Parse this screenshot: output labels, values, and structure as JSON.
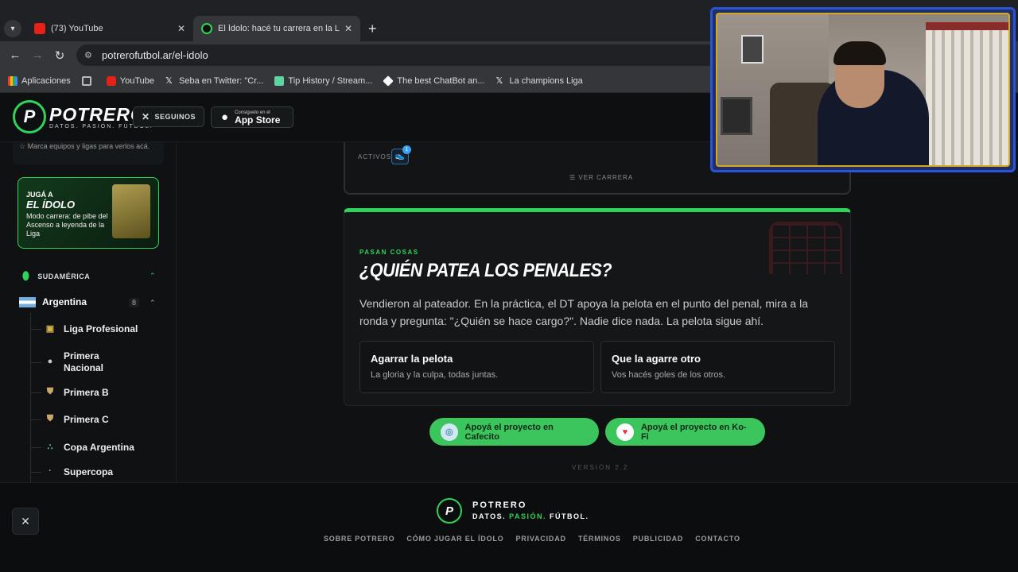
{
  "browser": {
    "tabs": [
      {
        "title": "(73) YouTube",
        "favicon": "youtube-icon"
      },
      {
        "title": "El Ídolo: hacé tu carrera en la Liga",
        "favicon": "potrero-icon"
      }
    ],
    "url": "potrerofutbol.ar/el-idolo",
    "bookmarks": [
      {
        "label": "Aplicaciones",
        "icon": "apps-grid-icon"
      },
      {
        "label": "",
        "icon": "grid-icon"
      },
      {
        "label": "YouTube",
        "icon": "youtube-icon"
      },
      {
        "label": "Seba en Twitter: \"Cr...",
        "icon": "x-icon"
      },
      {
        "label": "Tip History / Stream...",
        "icon": "streamelements-icon"
      },
      {
        "label": "The best ChatBot an...",
        "icon": "chatbot-icon"
      },
      {
        "label": "La champions Liga",
        "icon": "x-icon"
      }
    ]
  },
  "header": {
    "logo_name": "POTRERO",
    "logo_tagline": "DATOS. PASIÓN. FÚTBOL.",
    "seguinos_label": "SEGUINOS",
    "appstore_small": "Consiguelo en el",
    "appstore_big": "App Store"
  },
  "sidebar": {
    "favorites_hint": "Marca equipos y ligas para verlos acá.",
    "promo": {
      "line1": "JUGÁ A",
      "line2": "EL ÍDOLO",
      "line3": "Modo carrera: de pibe del Ascenso a leyenda de la Liga"
    },
    "region": "SUDAMÉRICA",
    "country": "Argentina",
    "country_count": "8",
    "leagues": [
      {
        "label": "Liga Profesional",
        "icon": "liga-profesional-icon"
      },
      {
        "label": "Primera Nacional",
        "icon": "primera-nacional-icon"
      },
      {
        "label": "Primera B",
        "icon": "primera-b-icon"
      },
      {
        "label": "Primera C",
        "icon": "primera-c-icon"
      },
      {
        "label": "Copa Argentina",
        "icon": "copa-argentina-icon"
      },
      {
        "label": "Supercopa",
        "icon": "supercopa-icon"
      }
    ]
  },
  "career": {
    "activos_label": "ACTIVOS",
    "activos_count": "1",
    "ver_carrera": "VER CARRERA"
  },
  "event": {
    "kicker": "PASAN COSAS",
    "title": "¿QUIÉN PATEA LOS PENALES?",
    "description": "Vendieron al pateador. En la práctica, el DT apoya la pelota en el punto del penal, mira a la ronda y pregunta: \"¿Quién se hace cargo?\". Nadie dice nada. La pelota sigue ahí.",
    "options": [
      {
        "title": "Agarrar la pelota",
        "desc": "La gloria y la culpa, todas juntas."
      },
      {
        "title": "Que la agarre otro",
        "desc": "Vos hacés goles de los otros."
      }
    ]
  },
  "support": {
    "cafecito": "Apoyá el proyecto en Cafecito",
    "kofi": "Apoyá el proyecto en Ko-Fi",
    "version": "VERSIÓN 2.2"
  },
  "footer": {
    "name": "POTRERO",
    "tag_a": "DATOS. ",
    "tag_b": "PASIÓN.",
    "tag_c": " FÚTBOL.",
    "links": [
      "SOBRE POTRERO",
      "CÓMO JUGAR EL ÍDOLO",
      "PRIVACIDAD",
      "TÉRMINOS",
      "PUBLICIDAD",
      "CONTACTO"
    ]
  },
  "colors": {
    "accent_green": "#2fd35a",
    "background": "#0f1112",
    "card": "#141618"
  }
}
